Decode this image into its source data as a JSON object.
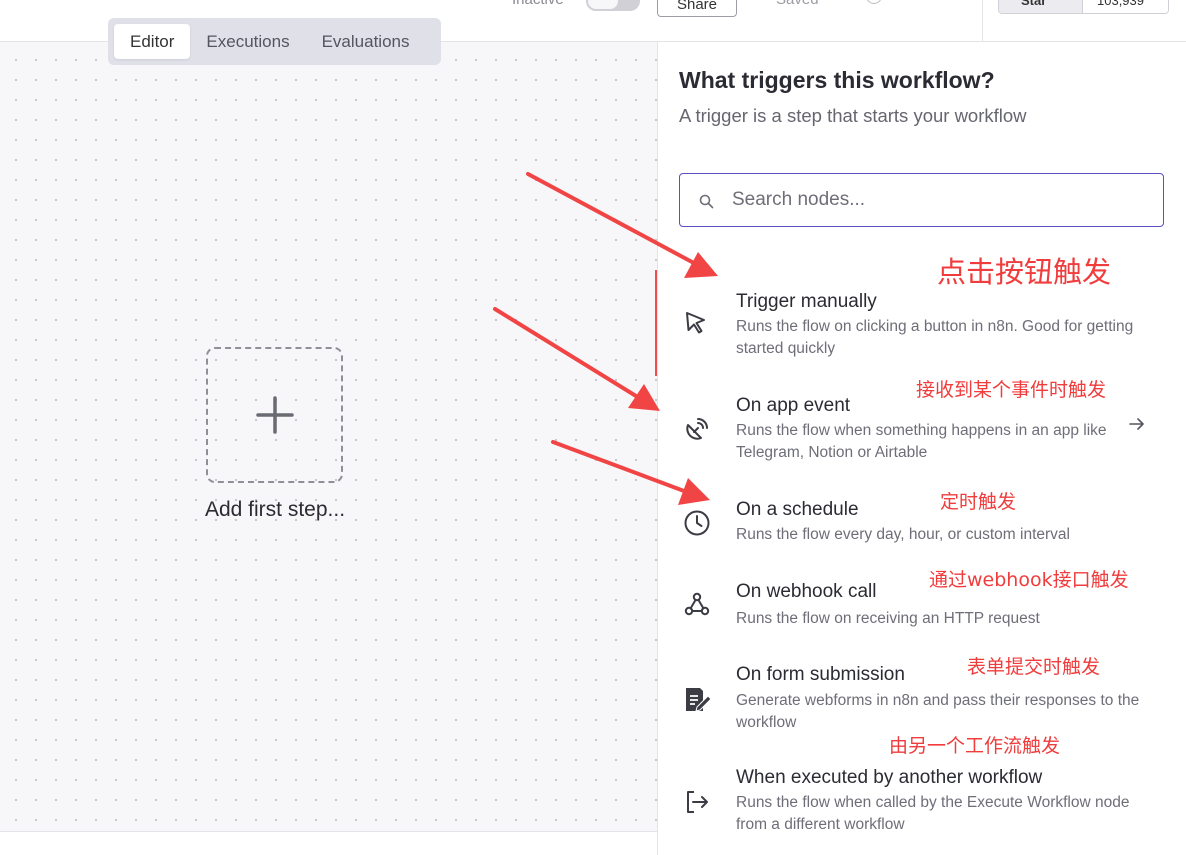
{
  "header": {
    "status_label": "Inactive",
    "share_label": "Share",
    "saved_label": "Saved",
    "github_star_label": "Star",
    "github_star_count": "103,939"
  },
  "tabs": [
    {
      "label": "Editor",
      "active": true
    },
    {
      "label": "Executions",
      "active": false
    },
    {
      "label": "Evaluations",
      "active": false
    }
  ],
  "canvas": {
    "add_first_step_label": "Add first step..."
  },
  "panel": {
    "title": "What triggers this workflow?",
    "subtitle": "A trigger is a step that starts your workflow",
    "search_placeholder": "Search nodes...",
    "items": [
      {
        "title": "Trigger manually",
        "description": "Runs the flow on clicking a button in n8n. Good for getting started quickly",
        "icon": "cursor-icon"
      },
      {
        "title": "On app event",
        "description": "Runs the flow when something happens in an app like Telegram, Notion or Airtable",
        "icon": "satellite-dish-icon"
      },
      {
        "title": "On a schedule",
        "description": "Runs the flow every day, hour, or custom interval",
        "icon": "clock-icon"
      },
      {
        "title": "On webhook call",
        "description": "Runs the flow on receiving an HTTP request",
        "icon": "webhook-icon"
      },
      {
        "title": "On form submission",
        "description": "Generate webforms in n8n and pass their responses to the workflow",
        "icon": "form-edit-icon"
      },
      {
        "title": "When executed by another workflow",
        "description": "Runs the flow when called by the Execute Workflow node from a different workflow",
        "icon": "sign-out-icon"
      }
    ]
  },
  "annotations": {
    "manual": "点击按钮触发",
    "app_event": "接收到某个事件时触发",
    "schedule": "定时触发",
    "webhook": "通过webhook接口触发",
    "form": "表单提交时触发",
    "another_workflow": "由另一个工作流触发"
  },
  "colors": {
    "accent": "#5b4fc4",
    "annotation_red": "#f03c3c",
    "canvas_bg": "#f7f7fa"
  }
}
